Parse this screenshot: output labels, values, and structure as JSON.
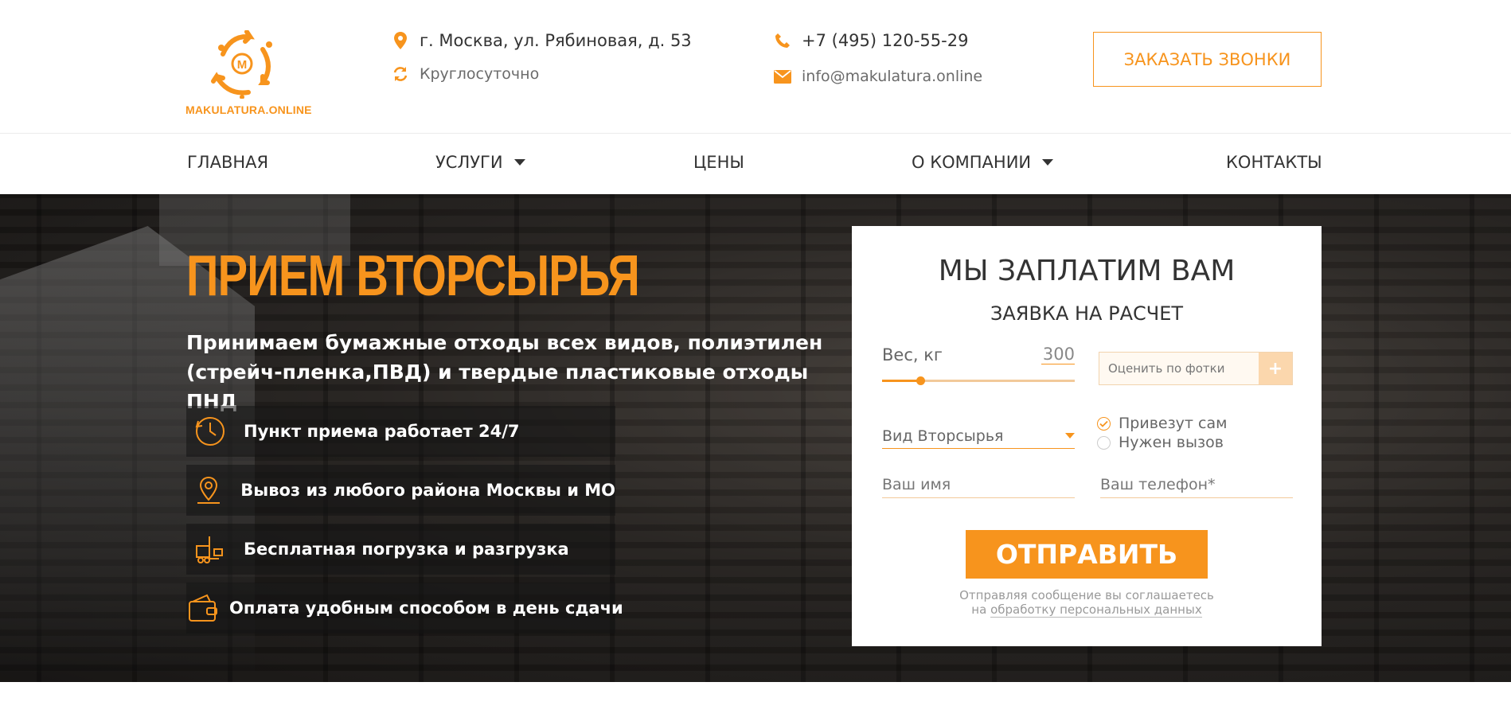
{
  "brand": {
    "logo_text": "MAKULATURA.ONLINE",
    "accent": "#f7941d"
  },
  "header": {
    "address": "г. Москва, ул. Рябиновая, д. 53",
    "hours": "Круглосуточно",
    "phone": "+7 (495) 120-55-29",
    "email": "info@makulatura.online",
    "call_button": "ЗАКАЗАТЬ ЗВОНКИ"
  },
  "nav": {
    "items": [
      {
        "label": "ГЛАВНАЯ"
      },
      {
        "label": "УСЛУГИ"
      },
      {
        "label": "ЦЕНЫ"
      },
      {
        "label": "О КОМПАНИИ"
      },
      {
        "label": "КОНТАКТЫ"
      }
    ]
  },
  "hero": {
    "title": "ПРИЕМ ВТОРСЫРЬЯ",
    "subtitle": "Принимаем бумажные отходы всех видов, полиэтилен (стрейч-пленка,ПВД) и твердые пластиковые отходы ПНД",
    "features": [
      {
        "icon": "clock-icon",
        "text": "Пункт приема работает 24/7"
      },
      {
        "icon": "map-pin-icon",
        "text": "Вывоз из любого района Москвы и МО"
      },
      {
        "icon": "forklift-icon",
        "text": "Бесплатная погрузка и разгрузка"
      },
      {
        "icon": "wallet-icon",
        "text": "Оплата удобным способом в день сдачи"
      }
    ]
  },
  "form": {
    "title": "МЫ ЗАПЛАТИМ ВАМ",
    "subtitle": "ЗАЯВКА НА РАСЧЕТ",
    "weight_label": "Вес, кг",
    "weight_value": "300",
    "weight_slider_fraction": 0.2,
    "photo_placeholder": "Оценить по фотки",
    "photo_button": "+",
    "type_select": "Вид Вторсырья",
    "radios": [
      {
        "label": "Привезут сам",
        "checked": true
      },
      {
        "label": "Нужен вызов",
        "checked": false
      }
    ],
    "name_placeholder": "Ваш имя",
    "phone_placeholder": "Ваш телефон*",
    "submit": "ОТПРАВИТЬ",
    "consent_line1": "Отправляя сообщение вы соглашаетесь",
    "consent_prefix": "на",
    "consent_link": "обработку персональных данных"
  }
}
